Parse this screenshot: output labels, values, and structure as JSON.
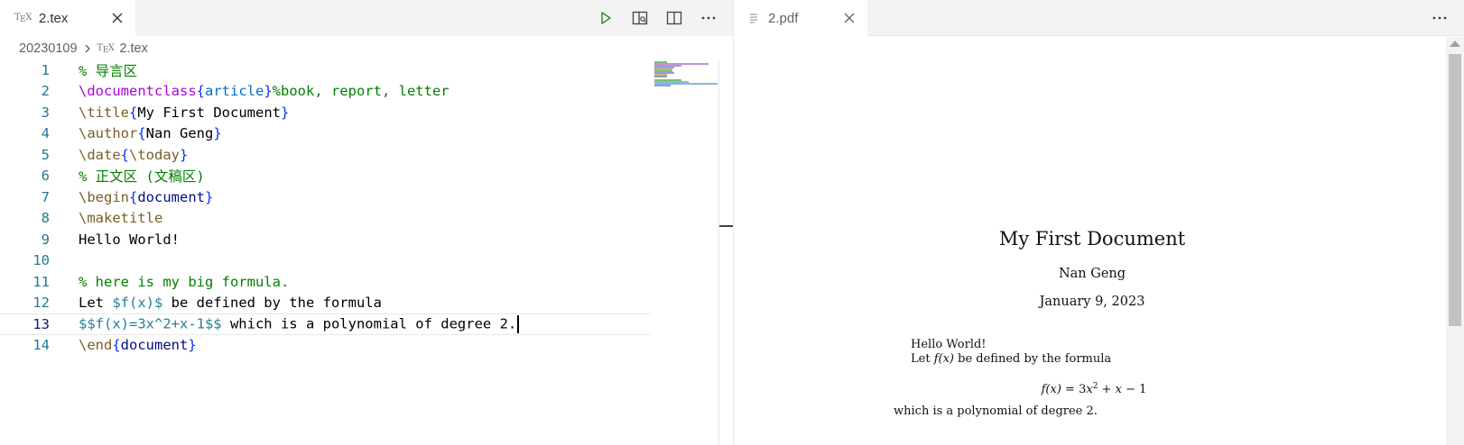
{
  "editor": {
    "tab": {
      "icon": "tex-icon",
      "label": "2.tex"
    },
    "toolbar": {
      "run_icon": "play-icon",
      "preview_icon": "open-preview-icon",
      "split_icon": "split-editor-icon",
      "more_icon": "more-actions-icon"
    },
    "breadcrumb": {
      "folder": "20230109",
      "file": "2.tex"
    },
    "lines": [
      {
        "n": "1",
        "tokens": [
          [
            "% 导言区",
            "comment"
          ]
        ]
      },
      {
        "n": "2",
        "tokens": [
          [
            "\\documentclass",
            "keyword"
          ],
          [
            "{",
            "brace"
          ],
          [
            "article",
            "arg"
          ],
          [
            "}",
            "brace"
          ],
          [
            "%book, report, letter",
            "comment"
          ]
        ]
      },
      {
        "n": "3",
        "tokens": [
          [
            "\\title",
            "macro"
          ],
          [
            "{",
            "brace"
          ],
          [
            "My First Document",
            "text"
          ],
          [
            "}",
            "brace"
          ]
        ]
      },
      {
        "n": "4",
        "tokens": [
          [
            "\\author",
            "macro"
          ],
          [
            "{",
            "brace"
          ],
          [
            "Nan Geng",
            "text"
          ],
          [
            "}",
            "brace"
          ]
        ]
      },
      {
        "n": "5",
        "tokens": [
          [
            "\\date",
            "macro"
          ],
          [
            "{",
            "brace"
          ],
          [
            "\\today",
            "macro"
          ],
          [
            "}",
            "brace"
          ]
        ]
      },
      {
        "n": "6",
        "tokens": [
          [
            "% 正文区 (文稿区)",
            "comment"
          ]
        ]
      },
      {
        "n": "7",
        "tokens": [
          [
            "\\begin",
            "macro"
          ],
          [
            "{",
            "brace"
          ],
          [
            "document",
            "argdark"
          ],
          [
            "}",
            "brace"
          ]
        ]
      },
      {
        "n": "8",
        "tokens": [
          [
            "\\maketitle",
            "macro"
          ]
        ]
      },
      {
        "n": "9",
        "tokens": [
          [
            "Hello World!",
            "text"
          ]
        ]
      },
      {
        "n": "10",
        "tokens": []
      },
      {
        "n": "11",
        "tokens": [
          [
            "% here is my big formula.",
            "comment"
          ]
        ]
      },
      {
        "n": "12",
        "tokens": [
          [
            "Let ",
            "text"
          ],
          [
            "$f(x)$",
            "math"
          ],
          [
            " be defined by the formula",
            "text"
          ]
        ]
      },
      {
        "n": "13",
        "tokens": [
          [
            "$$f(x)=3x^2+x-1$$",
            "math"
          ],
          [
            " which is a polynomial of degree 2.",
            "text"
          ]
        ]
      },
      {
        "n": "14",
        "tokens": [
          [
            "\\end",
            "macro"
          ],
          [
            "{",
            "brace"
          ],
          [
            "document",
            "argdark"
          ],
          [
            "}",
            "brace"
          ]
        ]
      }
    ],
    "current_line": 13
  },
  "pdf": {
    "tab": {
      "icon": "pdf-file-icon",
      "label": "2.pdf"
    },
    "more_icon": "more-actions-icon",
    "title": "My First Document",
    "author": "Nan Geng",
    "date": "January 9, 2023",
    "body_line1": "Hello World!",
    "body_line2_pre": "Let ",
    "body_line2_math": "f(x)",
    "body_line2_post": " be defined by the formula",
    "formula_lhs": "f(x)",
    "formula_mid": " = 3",
    "formula_x": "x",
    "formula_exp": "2",
    "formula_rest": " + ",
    "formula_x2": "x",
    "formula_tail": " − 1",
    "body_line3": "which is a polynomial of degree 2."
  }
}
